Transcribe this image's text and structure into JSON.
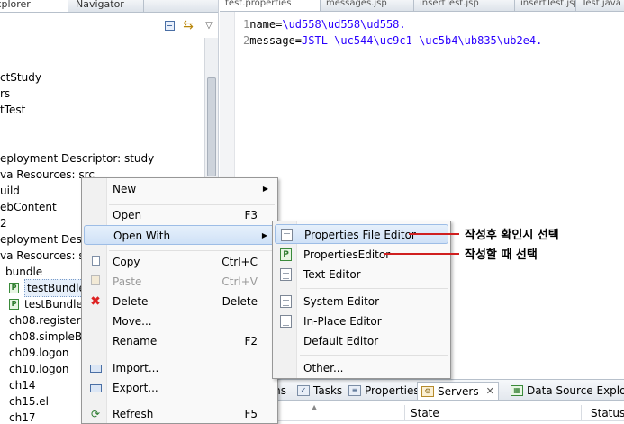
{
  "left_panel": {
    "tabs": [
      "Explorer",
      "Navigator"
    ],
    "tree": [
      {
        "label": "ctStudy"
      },
      {
        "label": "rs"
      },
      {
        "label": "tTest"
      },
      {
        "label": "eployment Descriptor: study"
      },
      {
        "label": "va Resources: src"
      },
      {
        "label": "uild"
      },
      {
        "label": "ebContent"
      },
      {
        "label": "2"
      },
      {
        "label": "eployment Descri"
      },
      {
        "label": "va Resources: src"
      },
      {
        "label": "bundle"
      },
      {
        "label": "testBundle_"
      },
      {
        "label": "testBundle."
      },
      {
        "label": "ch08.register"
      },
      {
        "label": "ch08.simpleBe"
      },
      {
        "label": "ch09.logon"
      },
      {
        "label": "ch10.logon"
      },
      {
        "label": "ch14"
      },
      {
        "label": "ch15.el"
      },
      {
        "label": "ch17"
      }
    ],
    "pkg_icon_letter": "P"
  },
  "editor": {
    "tabs": [
      "test.properties",
      "messages.jsp",
      "insertTest.jsp",
      "insertTest.jsp",
      "Test.java"
    ],
    "lines": [
      {
        "num": "1",
        "key": "name=",
        "value": "\\ud558\\ud558\\ud558."
      },
      {
        "num": "2",
        "key": "message=",
        "value": "JSTL \\uc544\\uc9c1 \\uc5b4\\ub835\\ub2e4."
      }
    ]
  },
  "context_menu": {
    "items": [
      {
        "label": "New",
        "shortcut": "",
        "submenu": true
      },
      {
        "label": "Open",
        "shortcut": "F3"
      },
      {
        "label": "Open With",
        "shortcut": "",
        "submenu": true
      },
      {
        "label": "Copy",
        "shortcut": "Ctrl+C"
      },
      {
        "label": "Paste",
        "shortcut": "Ctrl+V",
        "disabled": true
      },
      {
        "label": "Delete",
        "shortcut": "Delete"
      },
      {
        "label": "Move...",
        "shortcut": ""
      },
      {
        "label": "Rename",
        "shortcut": "F2"
      },
      {
        "label": "Import...",
        "shortcut": ""
      },
      {
        "label": "Export...",
        "shortcut": ""
      },
      {
        "label": "Refresh",
        "shortcut": "F5"
      }
    ],
    "arrow_glyph": "▶"
  },
  "submenu": {
    "items": [
      {
        "label": "Properties File Editor"
      },
      {
        "label": "PropertiesEditor"
      },
      {
        "label": "Text Editor"
      },
      {
        "label": "System Editor"
      },
      {
        "label": "In-Place Editor"
      },
      {
        "label": "Default Editor"
      },
      {
        "label": "Other..."
      }
    ]
  },
  "annotations": [
    {
      "text": "작성후 확인시 선택"
    },
    {
      "text": "작성할 때 선택"
    }
  ],
  "bottom_panel": {
    "tabs": {
      "problems": "ms",
      "tasks": "Tasks",
      "properties": "Properties",
      "servers": "Servers",
      "datasource": "Data Source Explor"
    },
    "close_glyph": "✕",
    "table_headers": {
      "state": "State",
      "status": "Status"
    }
  },
  "colors": {
    "property_value": "#2a00ff",
    "highlight_bg": "#cfe1f7",
    "annotation_line": "#d02020"
  }
}
